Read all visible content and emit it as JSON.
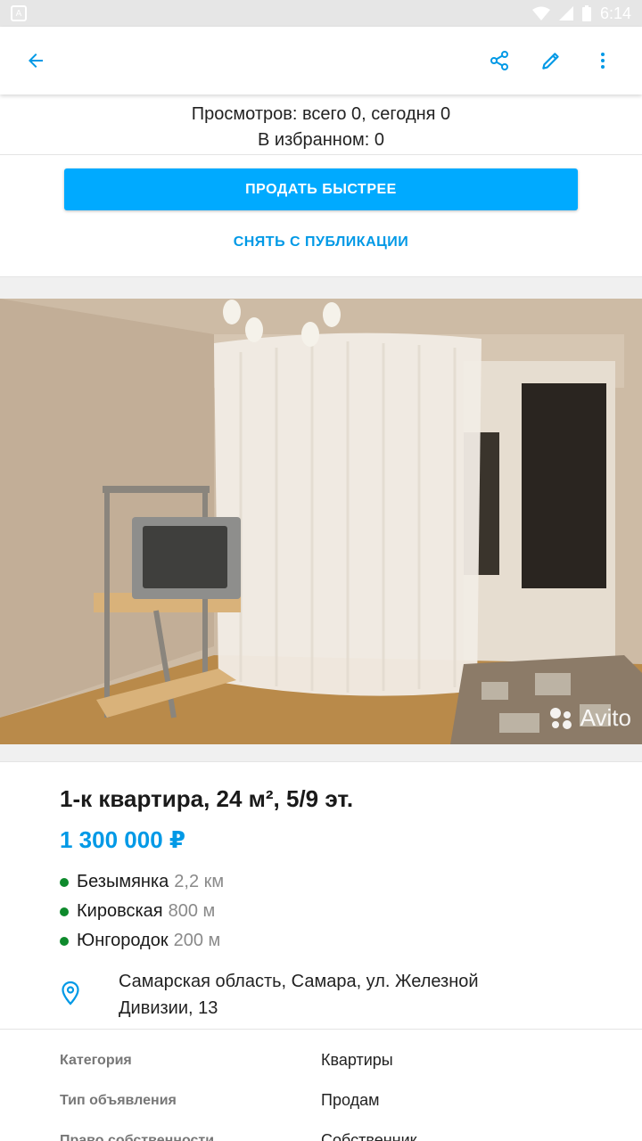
{
  "status_bar": {
    "time": "6:14",
    "icons": [
      "notification-icon",
      "wifi-icon",
      "signal-icon",
      "battery-icon"
    ]
  },
  "toolbar": {
    "icons": [
      "back-arrow-icon",
      "share-icon",
      "edit-pencil-icon",
      "more-vert-icon"
    ],
    "accent": "#0099e6"
  },
  "stats": {
    "views": "Просмотров: всего 0, сегодня 0",
    "favorites": "В избранном: 0"
  },
  "actions": {
    "sell_faster": "ПРОДАТЬ БЫСТРЕЕ",
    "unpublish": "СНЯТЬ С ПУБЛИКАЦИИ"
  },
  "photo": {
    "watermark": "Avito"
  },
  "listing": {
    "title": "1-к квартира, 24 м², 5/9 эт.",
    "price": "1 300 000 ₽",
    "metro": [
      {
        "name": "Безымянка",
        "distance": "2,2 км"
      },
      {
        "name": "Кировская",
        "distance": "800 м"
      },
      {
        "name": "Юнгородок",
        "distance": "200 м"
      }
    ],
    "address": "Самарская область, Самара, ул. Железной Дивизии, 13"
  },
  "properties": [
    {
      "key": "Категория",
      "value": "Квартиры"
    },
    {
      "key": "Тип объявления",
      "value": "Продам"
    },
    {
      "key": "Право собственности",
      "value": "Собственник"
    }
  ],
  "colors": {
    "primary_button": "#00aaff",
    "link": "#0099e6",
    "metro_dot": "#0e8a2c"
  }
}
